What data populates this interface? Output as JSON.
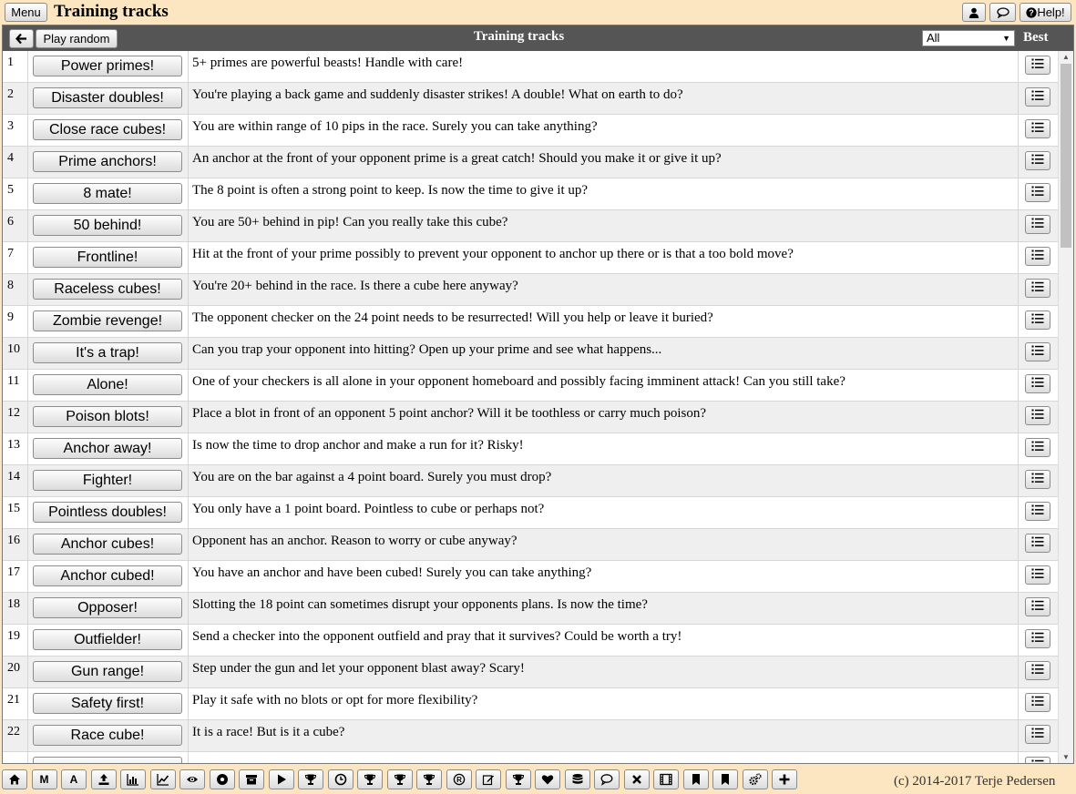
{
  "top": {
    "menu_label": "Menu",
    "title": "Training tracks",
    "help_label": "Help!",
    "icons": [
      "user-icon",
      "chat-icon",
      "help-icon"
    ]
  },
  "header": {
    "back_icon": "arrow-left-icon",
    "random_label": "Play random",
    "title": "Training tracks",
    "filter_value": "All",
    "best_label": "Best"
  },
  "tracks": [
    {
      "num": "1",
      "name": "Power primes!",
      "desc": "5+ primes are powerful beasts! Handle with care!"
    },
    {
      "num": "2",
      "name": "Disaster doubles!",
      "desc": "You're playing a back game and suddenly disaster strikes! A double! What on earth to do?"
    },
    {
      "num": "3",
      "name": "Close race cubes!",
      "desc": "You are within range of 10 pips in the race. Surely you can take anything?"
    },
    {
      "num": "4",
      "name": "Prime anchors!",
      "desc": "An anchor at the front of your opponent prime is a great catch! Should you make it or give it up?"
    },
    {
      "num": "5",
      "name": "8 mate!",
      "desc": "The 8 point is often a strong point to keep. Is now the time to give it up?"
    },
    {
      "num": "6",
      "name": "50 behind!",
      "desc": "You are 50+ behind in pip! Can you really take this cube?"
    },
    {
      "num": "7",
      "name": "Frontline!",
      "desc": "Hit at the front of your prime possibly to prevent your opponent to anchor up there or is that a too bold move?"
    },
    {
      "num": "8",
      "name": "Raceless cubes!",
      "desc": "You're 20+ behind in the race. Is there a cube here anyway?"
    },
    {
      "num": "9",
      "name": "Zombie revenge!",
      "desc": "The opponent checker on the 24 point needs to be resurrected! Will you help or leave it buried?"
    },
    {
      "num": "10",
      "name": "It's a trap!",
      "desc": "Can you trap your opponent into hitting? Open up your prime and see what happens..."
    },
    {
      "num": "11",
      "name": "Alone!",
      "desc": "One of your checkers is all alone in your opponent homeboard and possibly facing imminent attack! Can you still take?"
    },
    {
      "num": "12",
      "name": "Poison blots!",
      "desc": "Place a blot in front of an opponent 5 point anchor? Will it be toothless or carry much poison?"
    },
    {
      "num": "13",
      "name": "Anchor away!",
      "desc": "Is now the time to drop anchor and make a run for it? Risky!"
    },
    {
      "num": "14",
      "name": "Fighter!",
      "desc": "You are on the bar against a 4 point board. Surely you must drop?"
    },
    {
      "num": "15",
      "name": "Pointless doubles!",
      "desc": "You only have a 1 point board. Pointless to cube or perhaps not?"
    },
    {
      "num": "16",
      "name": "Anchor cubes!",
      "desc": "Opponent has an anchor. Reason to worry or cube anyway?"
    },
    {
      "num": "17",
      "name": "Anchor cubed!",
      "desc": "You have an anchor and have been cubed! Surely you can take anything?"
    },
    {
      "num": "18",
      "name": "Opposer!",
      "desc": "Slotting the 18 point can sometimes disrupt your opponents plans. Is now the time?"
    },
    {
      "num": "19",
      "name": "Outfielder!",
      "desc": "Send a checker into the opponent outfield and pray that it survives? Could be worth a try!"
    },
    {
      "num": "20",
      "name": "Gun range!",
      "desc": "Step under the gun and let your opponent blast away? Scary!"
    },
    {
      "num": "21",
      "name": "Safety first!",
      "desc": "Play it safe with no blots or opt for more flexibility?"
    },
    {
      "num": "22",
      "name": "Race cube!",
      "desc": "It is a race! But is it a cube?"
    }
  ],
  "toolbar": {
    "icons": [
      "home-icon",
      "m-icon",
      "a-icon",
      "upload-icon",
      "bar-chart-icon",
      "line-chart-icon",
      "eye-icon",
      "soccer-ball-icon",
      "archive-icon",
      "play-icon",
      "trophy-icon",
      "clock-icon",
      "trophy-icon",
      "trophy-icon",
      "trophy-icon",
      "registered-icon",
      "edit-icon",
      "trophy-icon",
      "heart-icon",
      "database-icon",
      "comment-icon",
      "close-icon",
      "film-icon",
      "bookmark-icon",
      "bookmark-icon",
      "cogs-icon",
      "plus-icon"
    ],
    "m_label": "M",
    "a_label": "A",
    "copyright": "(c) 2014-2017 Terje Pedersen"
  }
}
